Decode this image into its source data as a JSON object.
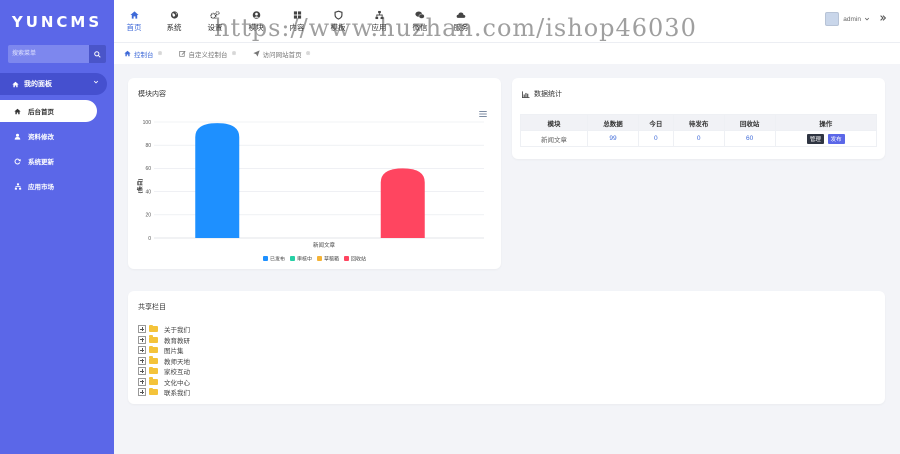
{
  "sidebar": {
    "logo": "YUNCMS",
    "search_placeholder": "搜索菜单",
    "group_label": "我的面板",
    "items": [
      {
        "label": "后台首页",
        "icon": "home-icon",
        "active": true
      },
      {
        "label": "资料修改",
        "icon": "user-icon",
        "active": false
      },
      {
        "label": "系统更新",
        "icon": "refresh-icon",
        "active": false
      },
      {
        "label": "应用市场",
        "icon": "sitemap-icon",
        "active": false
      }
    ]
  },
  "topnav": {
    "items": [
      {
        "label": "首页",
        "icon": "home-icon",
        "active": true
      },
      {
        "label": "系统",
        "icon": "globe-icon"
      },
      {
        "label": "设置",
        "icon": "gears-icon"
      },
      {
        "label": "模块",
        "icon": "user-circle-icon"
      },
      {
        "label": "内容",
        "icon": "grid-icon"
      },
      {
        "label": "模板",
        "icon": "shield-icon"
      },
      {
        "label": "应用",
        "icon": "sitemap-icon"
      },
      {
        "label": "微信",
        "icon": "wechat-icon"
      },
      {
        "label": "服务",
        "icon": "cloud-icon"
      }
    ],
    "watermark": "https://www.huzhan.com/ishop46030",
    "username": "admin"
  },
  "breadcrumbs": [
    {
      "label": "控制台",
      "icon": "home-icon",
      "active": true
    },
    {
      "label": "自定义控制台",
      "icon": "edit-icon",
      "active": false
    },
    {
      "label": "访问网站首页",
      "icon": "send-icon",
      "active": false
    }
  ],
  "chart_card": {
    "title": "模块内容"
  },
  "chart_data": {
    "type": "bar",
    "xlabel": "新闻文章",
    "ylabel": "(条目)",
    "y_ticks": [
      0,
      20,
      40,
      60,
      80,
      100
    ],
    "ylim": [
      0,
      100
    ],
    "grid": true,
    "legend_position": "bottom",
    "series": [
      {
        "name": "已发布",
        "value": 99,
        "color": "#1e90ff"
      },
      {
        "name": "审核中",
        "value": 0,
        "color": "#26d0a5"
      },
      {
        "name": "草稿箱",
        "value": 0,
        "color": "#f5b335"
      },
      {
        "name": "回收站",
        "value": 60,
        "color": "#ff4560"
      }
    ]
  },
  "stats_card": {
    "title": "数据统计",
    "headers": [
      "模块",
      "总数据",
      "今日",
      "待发布",
      "回收站",
      "操作"
    ],
    "rows": [
      {
        "module": "新闻文章",
        "total": "99",
        "today": "0",
        "pending": "0",
        "recycle": "60",
        "btn_manage": "管理",
        "btn_publish": "发布"
      }
    ],
    "btn_manage_color": "#2f3542",
    "btn_publish_color": "#5b67e8"
  },
  "tree_card": {
    "title": "共享栏目",
    "items": [
      "关于我们",
      "教育教研",
      "图片集",
      "教师天地",
      "家校互动",
      "文化中心",
      "联系我们"
    ]
  }
}
